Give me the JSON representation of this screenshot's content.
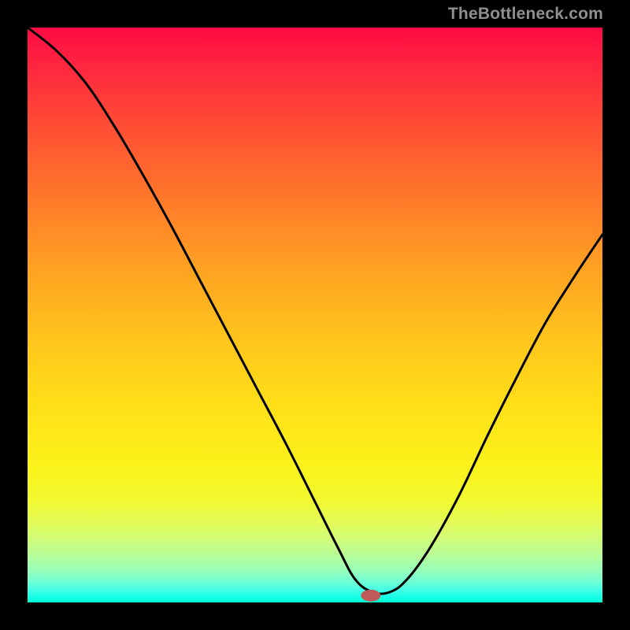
{
  "watermark": "TheBottleneck.com",
  "marker": {
    "x": 0.597,
    "y_frac_from_top": 0.988,
    "rx": 12,
    "ry": 7
  },
  "chart_data": {
    "type": "line",
    "title": "",
    "xlabel": "",
    "ylabel": "",
    "xlim": [
      0,
      1
    ],
    "ylim": [
      0,
      1
    ],
    "note": "x is normalized horizontal position across the colored plot area (0=left edge, 1=right edge). y is normalized value where 0 = bottom (green) and 1 = top (red). The black curve descends steeply from the top-left, flattens into a short plateau near the bottom around x≈0.58–0.62, then rises toward the right edge reaching roughly y≈0.64 at x=1. A small rounded marker sits at the trough.",
    "series": [
      {
        "name": "curve",
        "x": [
          0.0,
          0.05,
          0.1,
          0.15,
          0.2,
          0.25,
          0.3,
          0.35,
          0.4,
          0.45,
          0.5,
          0.54,
          0.57,
          0.6,
          0.63,
          0.66,
          0.7,
          0.75,
          0.8,
          0.85,
          0.9,
          0.95,
          1.0
        ],
        "y": [
          1.0,
          0.96,
          0.905,
          0.83,
          0.745,
          0.655,
          0.56,
          0.465,
          0.37,
          0.275,
          0.175,
          0.095,
          0.04,
          0.018,
          0.018,
          0.04,
          0.095,
          0.185,
          0.29,
          0.39,
          0.485,
          0.565,
          0.64
        ]
      }
    ],
    "gradient_stops": [
      {
        "pos": 0.0,
        "color": "#ff0b44"
      },
      {
        "pos": 0.3,
        "color": "#ff7a2a"
      },
      {
        "pos": 0.66,
        "color": "#ffe018"
      },
      {
        "pos": 0.88,
        "color": "#d0fc7a"
      },
      {
        "pos": 1.0,
        "color": "#00ffcf"
      }
    ]
  }
}
